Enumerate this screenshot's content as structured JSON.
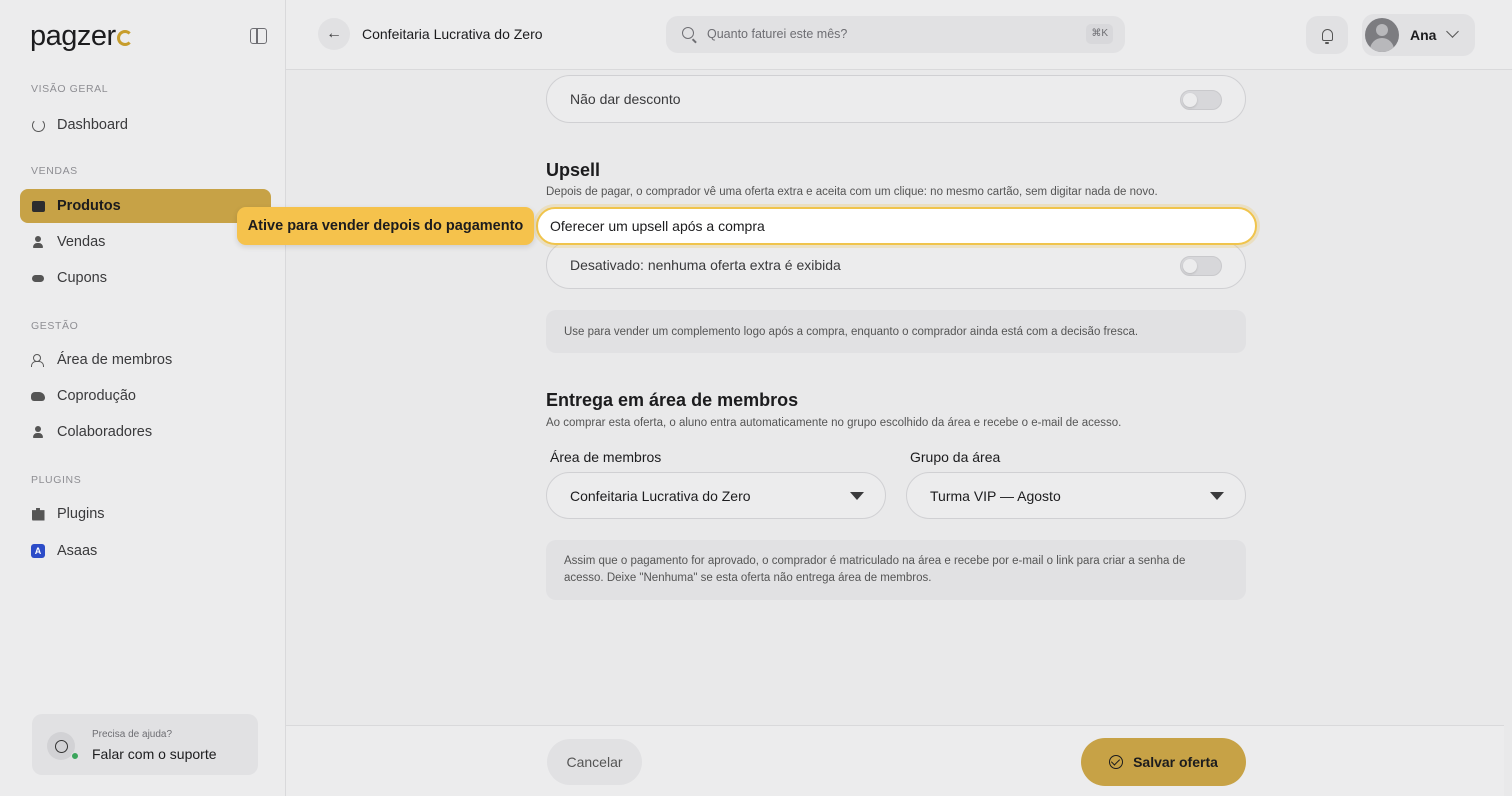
{
  "brand": {
    "name": "pagzer",
    "accent": "#c79d2c"
  },
  "sidebar": {
    "sections": [
      {
        "label": "VISÃO GERAL"
      },
      {
        "label": "VENDAS"
      },
      {
        "label": "GESTÃO"
      },
      {
        "label": "PLUGINS"
      }
    ],
    "items": [
      {
        "label": "Dashboard",
        "icon": "dashboard-icon"
      },
      {
        "label": "Produtos",
        "icon": "box-icon",
        "active": true
      },
      {
        "label": "Vendas",
        "icon": "person-icon"
      },
      {
        "label": "Cupons",
        "icon": "ticket-icon"
      },
      {
        "label": "Área de membros",
        "icon": "users-icon"
      },
      {
        "label": "Coprodução",
        "icon": "handshake-icon"
      },
      {
        "label": "Colaboradores",
        "icon": "person-icon"
      },
      {
        "label": "Plugins",
        "icon": "puzzle-icon"
      },
      {
        "label": "Asaas",
        "icon": "asaas-icon",
        "badge": "A"
      }
    ],
    "support": {
      "title": "Precisa de ajuda?",
      "action": "Falar com o suporte"
    }
  },
  "topbar": {
    "title": "Confeitaria Lucrativa do Zero",
    "search": {
      "placeholder": "Quanto faturei este mês?",
      "shortcut": "⌘K"
    },
    "user": {
      "name": "Ana"
    }
  },
  "main": {
    "discount_option": "Não dar desconto",
    "upsell": {
      "heading": "Upsell",
      "description": "Depois de pagar, o comprador vê uma oferta extra e aceita com um clique: no mesmo cartão, sem digitar nada de novo.",
      "toggle_label": "Oferecer um upsell após a compra",
      "status": "Desativado: nenhuma oferta extra é exibida",
      "info": "Use para vender um complemento logo após a compra, enquanto o comprador ainda está com a decisão fresca."
    },
    "members": {
      "heading": "Entrega em área de membros",
      "description": "Ao comprar esta oferta, o aluno entra automaticamente no grupo escolhido da área e recebe o e-mail de acesso.",
      "area_label": "Área de membros",
      "area_value": "Confeitaria Lucrativa do Zero",
      "group_label": "Grupo da área",
      "group_value": "Turma VIP — Agosto",
      "info": "Assim que o pagamento for aprovado, o comprador é matriculado na área e recebe por e-mail o link para criar a senha de acesso. Deixe \"Nenhuma\" se esta oferta não entrega área de membros."
    }
  },
  "callout": {
    "text": "Ative para vender depois do pagamento",
    "color": "#f5c24c"
  },
  "footer": {
    "cancel": "Cancelar",
    "save": "Salvar oferta"
  }
}
